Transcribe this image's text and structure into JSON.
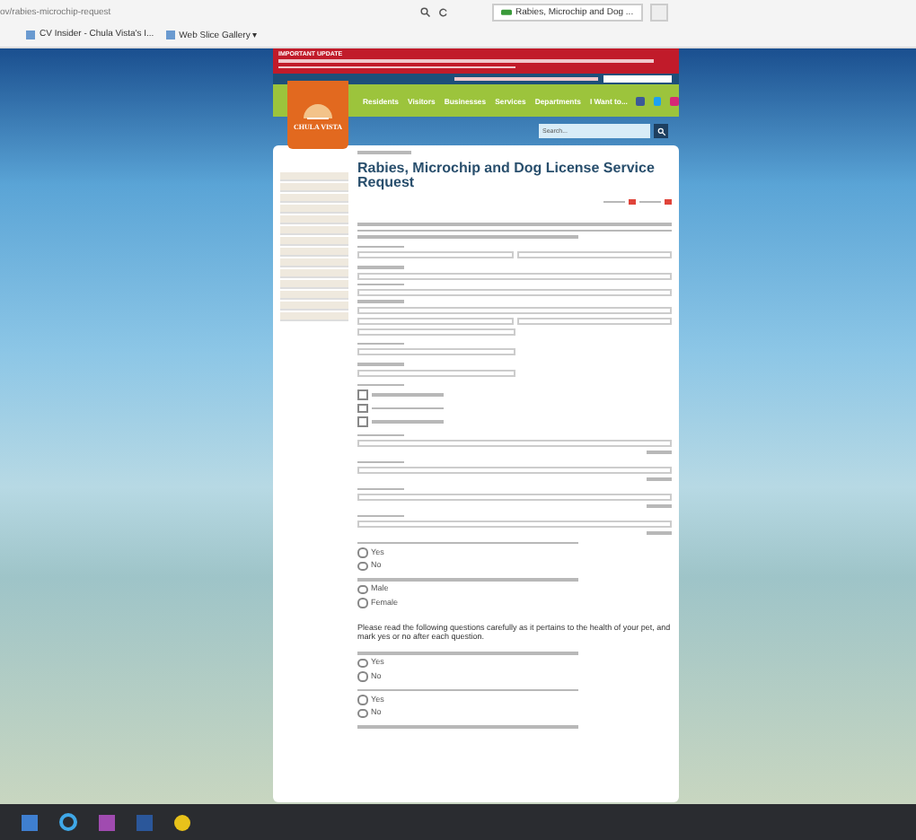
{
  "browser": {
    "address": "ov/rabies-microchip-request",
    "tab": "Rabies, Microchip and Dog ...",
    "favorites": [
      {
        "label": "CV Insider - Chula Vista's I..."
      },
      {
        "label": "Web Slice Gallery ▾"
      }
    ]
  },
  "banner": {
    "title": "IMPORTANT UPDATE"
  },
  "logo": {
    "text": "CHULA VISTA"
  },
  "nav": [
    "Residents",
    "Visitors",
    "Businesses",
    "Services",
    "Departments",
    "I Want to..."
  ],
  "search": {
    "placeholder": "Search..."
  },
  "page": {
    "title": "Rabies, Microchip and Dog License Service Request"
  },
  "form": [
    {
      "kind": "para"
    },
    {
      "kind": "name"
    },
    {
      "kind": "address"
    },
    {
      "kind": "input"
    },
    {
      "kind": "input"
    },
    {
      "kind": "checks",
      "options": [
        {
          "checked": false
        },
        {
          "checked": false
        },
        {
          "checked": false
        }
      ]
    },
    {
      "kind": "textarea"
    },
    {
      "kind": "textarea"
    },
    {
      "kind": "textarea"
    },
    {
      "kind": "textarea"
    },
    {
      "kind": "radios",
      "options": [
        {
          "label": "Yes",
          "selected": false
        },
        {
          "label": "No",
          "selected": false
        }
      ]
    },
    {
      "kind": "radios",
      "options": [
        {
          "label": "Male",
          "selected": false
        },
        {
          "label": "Female",
          "selected": false
        }
      ]
    },
    {
      "kind": "heading",
      "text": "Please read the following questions carefully as it pertains to the health of your pet, and mark yes or no after each question."
    },
    {
      "kind": "radios",
      "options": [
        {
          "label": "Yes",
          "selected": false
        },
        {
          "label": "No",
          "selected": false
        }
      ]
    },
    {
      "kind": "radios",
      "options": [
        {
          "label": "Yes",
          "selected": false
        },
        {
          "label": "No",
          "selected": false
        }
      ]
    },
    {
      "kind": "question"
    }
  ]
}
